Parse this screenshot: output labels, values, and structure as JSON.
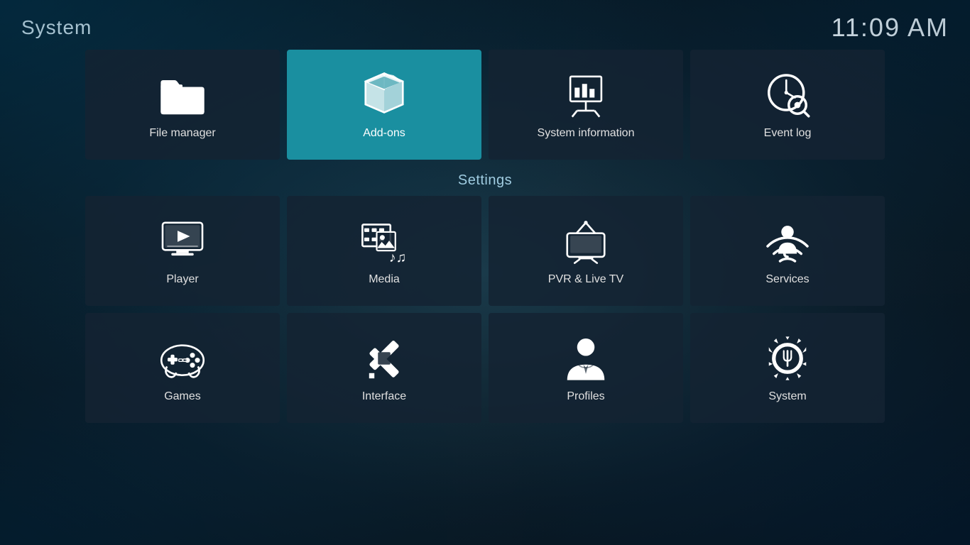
{
  "header": {
    "title": "System",
    "time": "11:09 AM"
  },
  "settings_label": "Settings",
  "top_row": [
    {
      "id": "file-manager",
      "label": "File manager",
      "icon": "folder"
    },
    {
      "id": "add-ons",
      "label": "Add-ons",
      "icon": "addons",
      "active": true
    },
    {
      "id": "system-information",
      "label": "System information",
      "icon": "sysinfo"
    },
    {
      "id": "event-log",
      "label": "Event log",
      "icon": "eventlog"
    }
  ],
  "settings_row1": [
    {
      "id": "player",
      "label": "Player",
      "icon": "player"
    },
    {
      "id": "media",
      "label": "Media",
      "icon": "media"
    },
    {
      "id": "pvr-livetv",
      "label": "PVR & Live TV",
      "icon": "pvr"
    },
    {
      "id": "services",
      "label": "Services",
      "icon": "services"
    }
  ],
  "settings_row2": [
    {
      "id": "games",
      "label": "Games",
      "icon": "games"
    },
    {
      "id": "interface",
      "label": "Interface",
      "icon": "interface"
    },
    {
      "id": "profiles",
      "label": "Profiles",
      "icon": "profiles"
    },
    {
      "id": "system",
      "label": "System",
      "icon": "systemsettings"
    }
  ]
}
